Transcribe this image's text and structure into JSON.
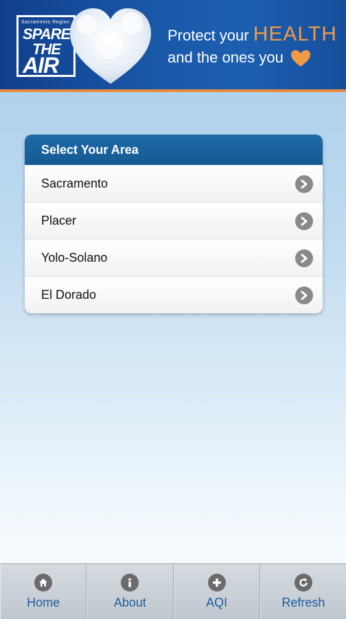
{
  "banner": {
    "logo_region": "Sacramento Region",
    "logo_line1": "SPARE",
    "logo_line2": "THE",
    "logo_line3": "AIR",
    "tagline_line1_prefix": "Protect your",
    "tagline_line1_emphasis": "HEALTH",
    "tagline_line2": "and the ones you",
    "accent_color": "#f09a45"
  },
  "area_panel": {
    "title": "Select Your Area",
    "items": [
      {
        "label": "Sacramento",
        "icon": "chevron-right-icon"
      },
      {
        "label": "Placer",
        "icon": "chevron-right-icon"
      },
      {
        "label": "Yolo-Solano",
        "icon": "chevron-right-icon"
      },
      {
        "label": "El Dorado",
        "icon": "chevron-right-icon"
      }
    ]
  },
  "tabbar": {
    "tabs": [
      {
        "label": "Home",
        "icon": "home-icon"
      },
      {
        "label": "About",
        "icon": "info-icon"
      },
      {
        "label": "AQI",
        "icon": "plus-icon"
      },
      {
        "label": "Refresh",
        "icon": "refresh-icon"
      }
    ]
  }
}
